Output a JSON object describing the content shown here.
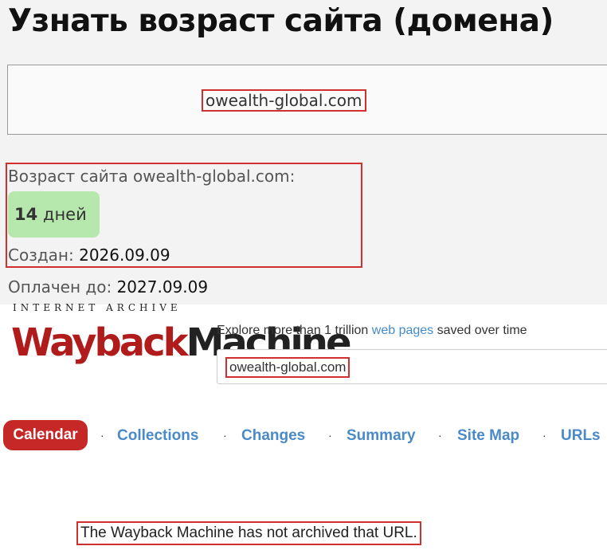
{
  "age_tool": {
    "title": "Узнать возраст сайта (домена)",
    "domain_input_value": "owealth-global.com",
    "age_label": "Возраст сайта owealth-global.com:",
    "age_number": "14",
    "age_unit": "дней",
    "created_label": "Создан:",
    "created_value": "2026.09.09",
    "paid_label": "Оплачен до:",
    "paid_value": "2027.09.09"
  },
  "wayback": {
    "ia_text": "INTERNET ARCHIVE",
    "logo_word_1": "Wayback",
    "logo_word_2": "Machine",
    "tagline_before": "Explore more than 1 trillion",
    "tagline_link": "web pages",
    "tagline_after": "saved over time",
    "search_value": "owealth-global.com",
    "tabs": [
      "Calendar",
      "Collections",
      "Changes",
      "Summary",
      "Site Map",
      "URLs"
    ],
    "separator": "·",
    "message": "The Wayback Machine has not archived that URL."
  },
  "colors": {
    "highlight_border": "#d32f2f",
    "age_badge_bg": "#b6e8ae",
    "wayback_red": "#b01c1c",
    "tab_active_bg": "#c62828",
    "link_blue": "#428bca"
  }
}
